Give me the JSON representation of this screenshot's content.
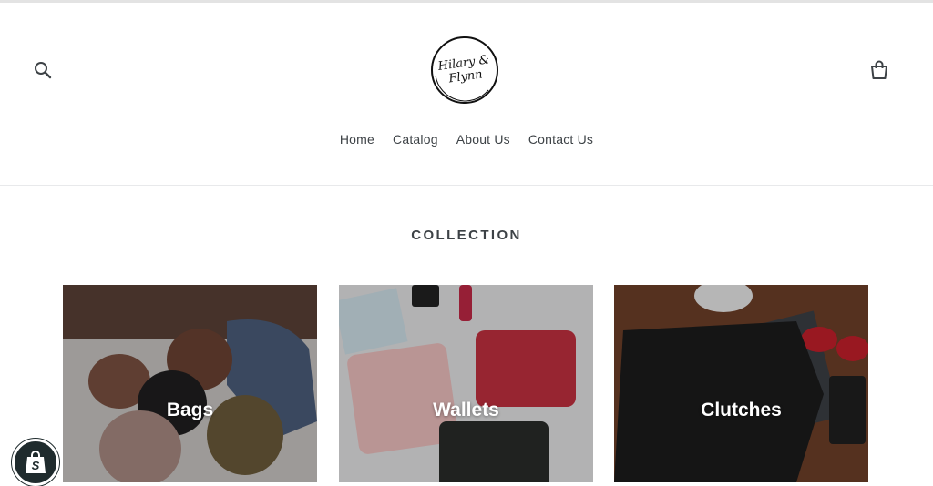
{
  "header": {
    "logo_line1": "Hilary &",
    "logo_line2": "Flynn"
  },
  "nav": {
    "items": [
      {
        "label": "Home"
      },
      {
        "label": "Catalog"
      },
      {
        "label": "About Us"
      },
      {
        "label": "Contact Us"
      }
    ]
  },
  "collection": {
    "title": "COLLECTION",
    "cards": [
      {
        "label": "Bags"
      },
      {
        "label": "Wallets"
      },
      {
        "label": "Clutches"
      }
    ]
  },
  "icons": {
    "search": "search-icon",
    "cart": "cart-icon",
    "shopify": "shopify-bag-icon"
  },
  "colors": {
    "text": "#3d4246",
    "badge": "#1f2b2d"
  }
}
